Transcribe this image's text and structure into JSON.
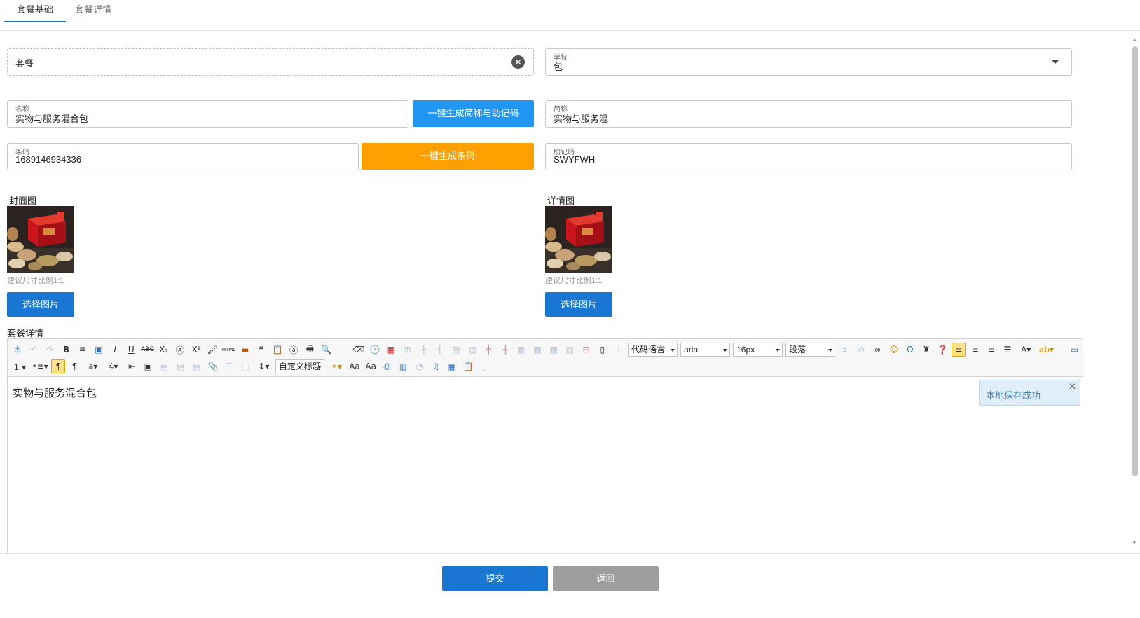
{
  "tabs": [
    {
      "label": "套餐基础",
      "active": true
    },
    {
      "label": "套餐详情",
      "active": false
    }
  ],
  "form": {
    "type_value": "套餐",
    "unit": {
      "label": "单位",
      "value": "包"
    },
    "name": {
      "label": "名称",
      "value": "实物与服务混合包"
    },
    "gen_short_button": "一键生成简称与助记码",
    "short_name": {
      "label": "简称",
      "value": "实物与服务混"
    },
    "barcode": {
      "label": "条码",
      "value": "1689146934336"
    },
    "gen_barcode_button": "一键生成条码",
    "mnemonic": {
      "label": "助记码",
      "value": "SWYFWH"
    }
  },
  "images": {
    "cover": {
      "label": "封面图",
      "hint": "建议尺寸比例1:1",
      "button": "选择图片"
    },
    "detail": {
      "label": "详情图",
      "hint": "建议尺寸比例1:1",
      "button": "选择图片"
    }
  },
  "editor": {
    "label": "套餐详情",
    "selects": {
      "code": "代码语言",
      "font": "arial",
      "size": "16px",
      "paragraph": "段落",
      "title": "自定义标题"
    },
    "content": "实物与服务混合包",
    "toast": "本地保存成功"
  },
  "footer": {
    "submit": "提交",
    "back": "返回"
  },
  "colors": {
    "accent": "#2196f3",
    "primary": "#1976d2",
    "orange": "#ffa000",
    "grey": "#9e9e9e"
  }
}
